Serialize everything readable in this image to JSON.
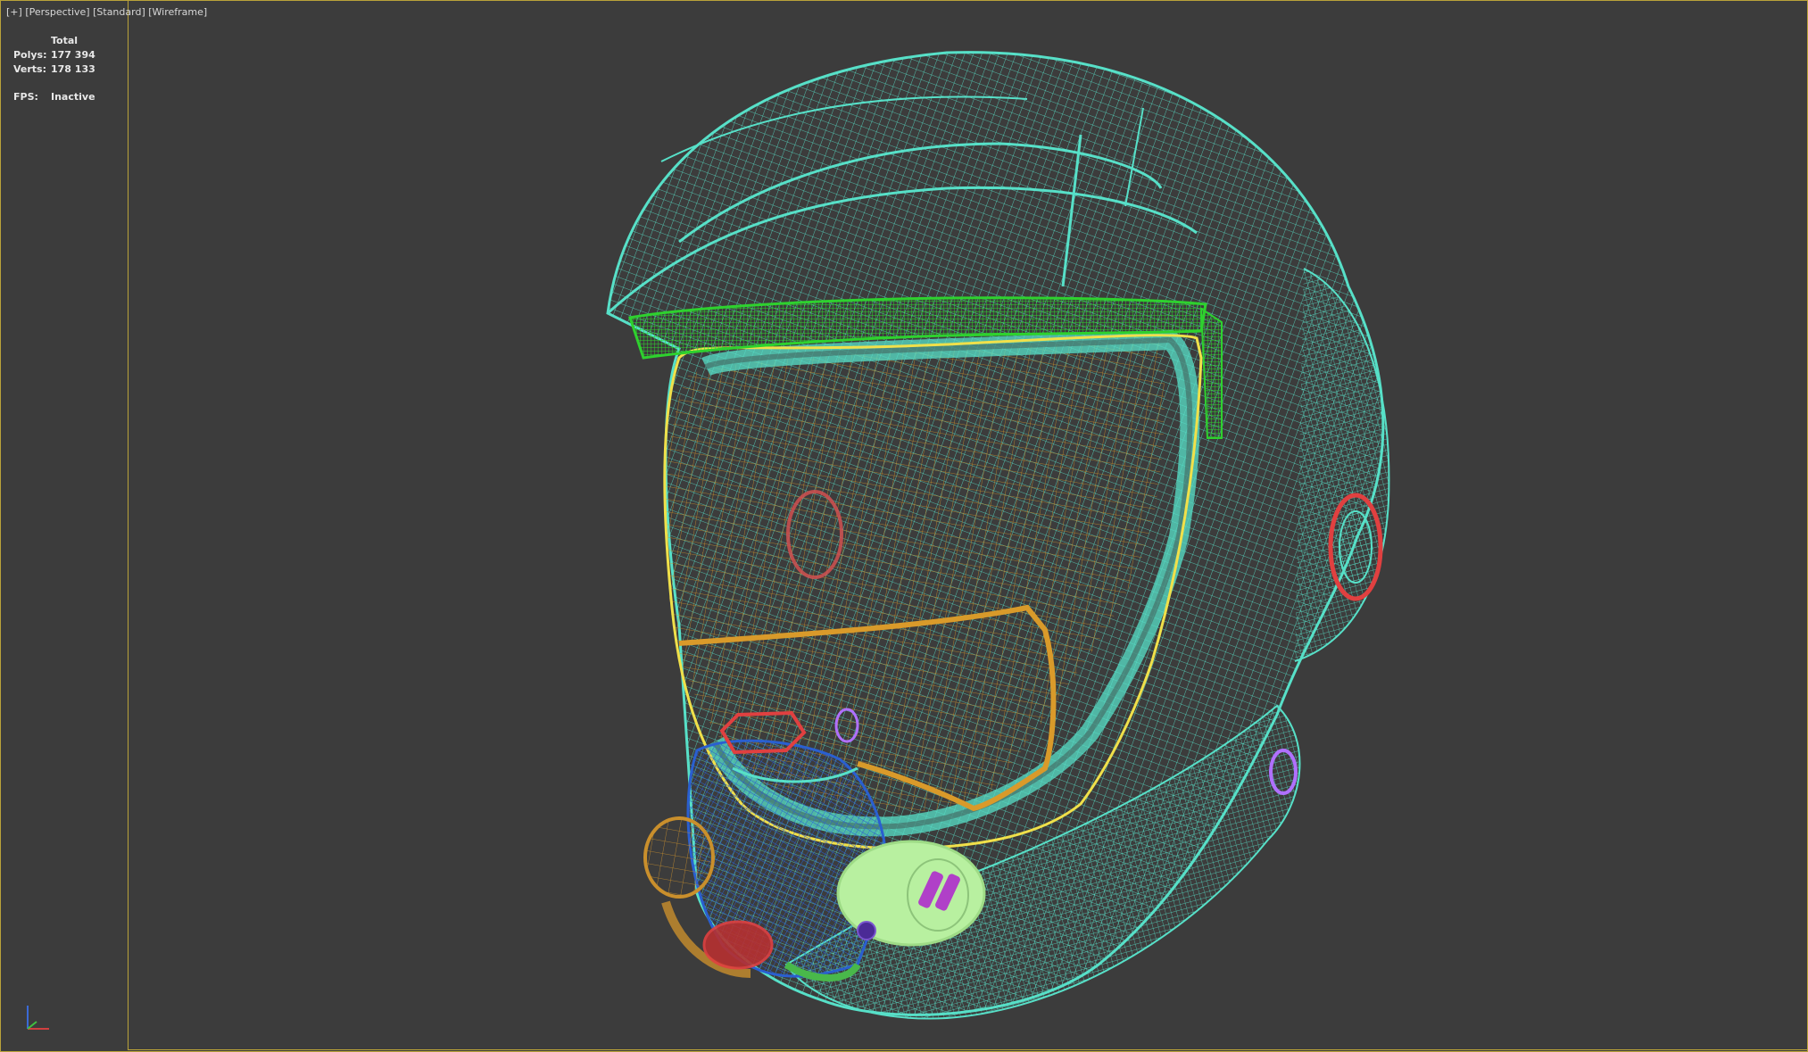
{
  "viewport": {
    "menu": {
      "plus_label": "[+]",
      "view_label": "[Perspective]",
      "shading_label": "[Standard]",
      "mode_label": "[Wireframe]"
    },
    "stats": {
      "header": "Total",
      "polys_label": "Polys:",
      "polys_value": "177 394",
      "verts_label": "Verts:",
      "verts_value": "178 133",
      "fps_label": "FPS:",
      "fps_value": "Inactive"
    },
    "gizmo": {
      "axes": [
        "x",
        "y",
        "z"
      ]
    }
  },
  "colors": {
    "background": "#3c3c3c",
    "frame": "#b9a23a",
    "helmet_wire": "#57e0c8",
    "visor_frame": "#f0e04a",
    "visor_inner": "#d99a2a",
    "brow_strip": "#2ed12e",
    "red_parts": "#e04040",
    "blue_parts": "#2a5fd0",
    "purple_parts": "#b070ff",
    "filter_canister": "#b8f0a0"
  }
}
